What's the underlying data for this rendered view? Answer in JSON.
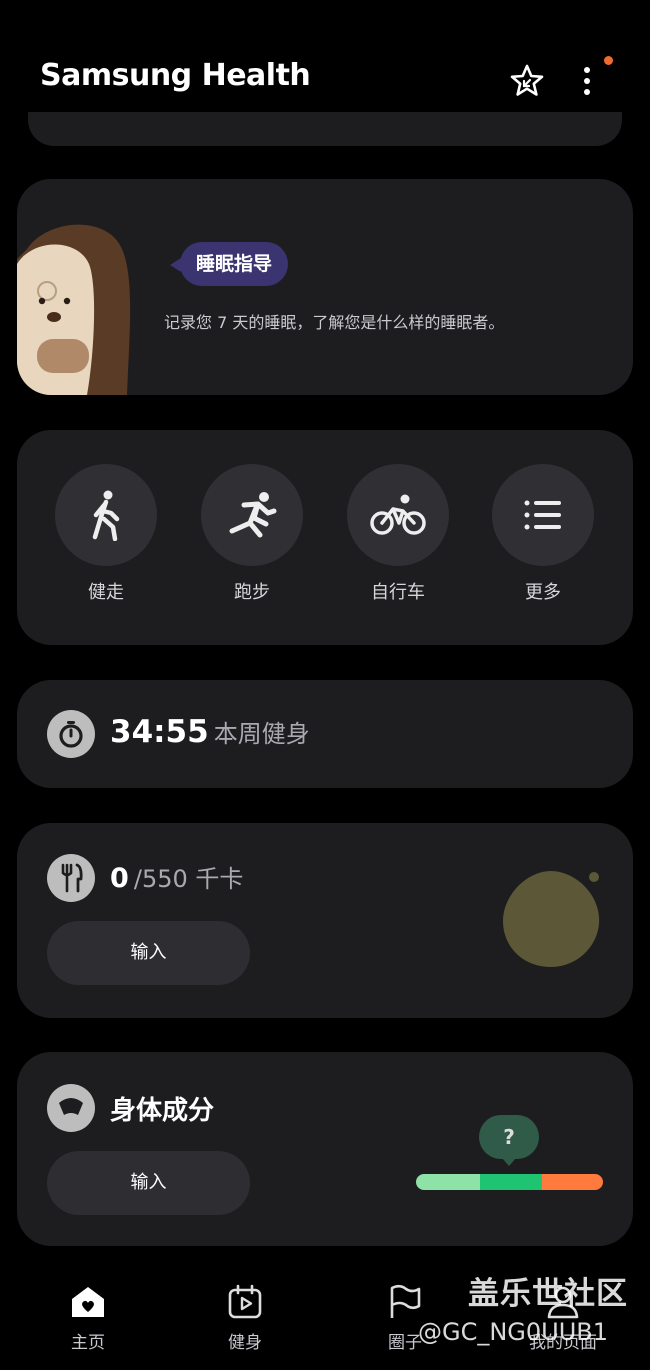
{
  "header": {
    "title": "Samsung Health"
  },
  "sleep_card": {
    "badge": "睡眠指导",
    "description": "记录您 7 天的睡眠，了解您是什么样的睡眠者。"
  },
  "activity": {
    "items": [
      {
        "label": "健走",
        "icon": "walking-icon"
      },
      {
        "label": "跑步",
        "icon": "running-icon"
      },
      {
        "label": "自行车",
        "icon": "cycling-icon"
      },
      {
        "label": "更多",
        "icon": "list-icon"
      }
    ]
  },
  "workout": {
    "time": "34:55",
    "label": "本周健身"
  },
  "food": {
    "value": "0",
    "goal": "/550 千卡",
    "input_label": "输入"
  },
  "body": {
    "title": "身体成分",
    "input_label": "输入",
    "help": "?"
  },
  "nav": {
    "items": [
      {
        "label": "主页",
        "icon": "home-icon"
      },
      {
        "label": "健身",
        "icon": "fitness-icon"
      },
      {
        "label": "圈子",
        "icon": "flag-icon"
      },
      {
        "label": "我的页面",
        "icon": "person-icon"
      }
    ]
  },
  "watermark": {
    "line1": "盖乐世社区",
    "line2": "@GC_NG0UUB1"
  },
  "colors": {
    "background": "#000000",
    "card": "#1d1d20",
    "badge": "#3a3470",
    "accent_orange": "#f06b2e",
    "bar_light_green": "#8ee2a8",
    "bar_green": "#1fc472",
    "bar_orange": "#ff7a3d"
  }
}
